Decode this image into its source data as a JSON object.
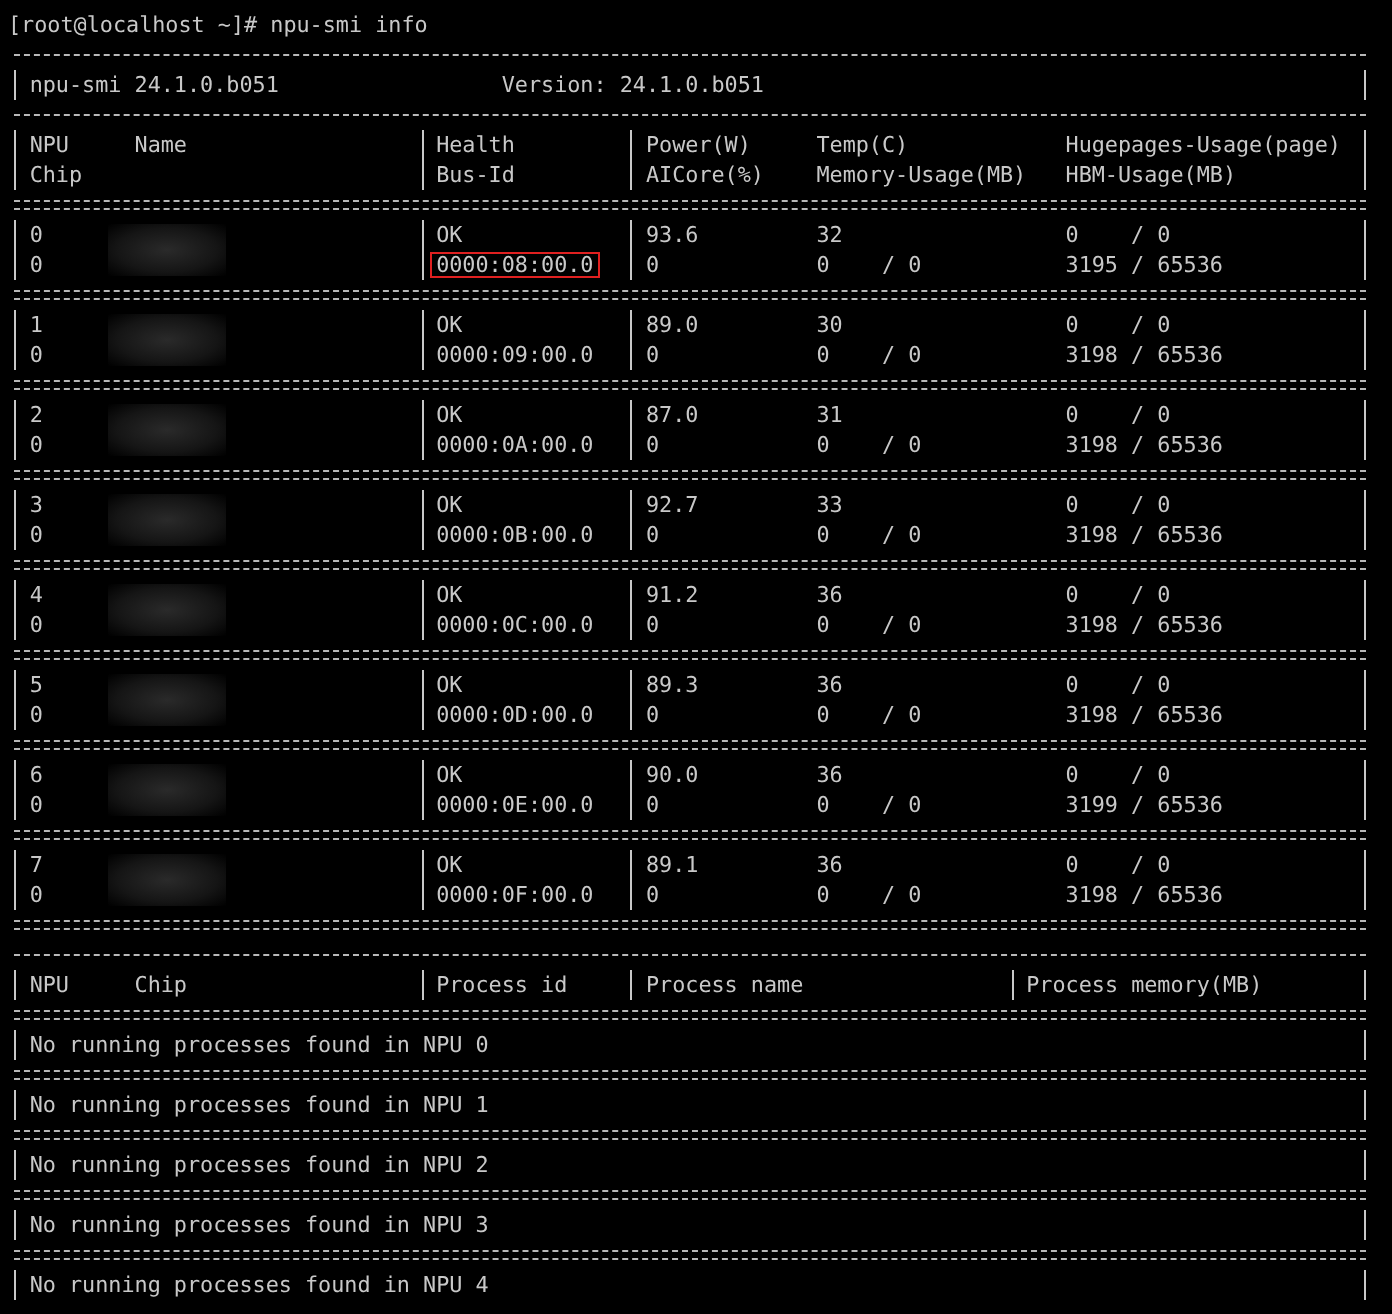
{
  "prompt": "[root@localhost ~]# npu-smi info",
  "header": {
    "tool": "npu-smi 24.1.0.b051",
    "version": "Version: 24.1.0.b051"
  },
  "columns": {
    "npu": "NPU",
    "name": "Name",
    "chip": "Chip",
    "health": "Health",
    "bus_id": "Bus-Id",
    "power": "Power(W)",
    "aicore": "AICore(%)",
    "temp": "Temp(C)",
    "memory": "Memory-Usage(MB)",
    "hugepages": "Hugepages-Usage(page)",
    "hbm": "HBM-Usage(MB)"
  },
  "npus": [
    {
      "npu": "0",
      "chip": "0",
      "health": "OK",
      "bus_id": "0000:08:00.0",
      "highlighted": true,
      "power": "93.6",
      "aicore": "0",
      "temp": "32",
      "memory": "0    / 0",
      "hugepages": "0    / 0",
      "hbm": "3195 / 65536"
    },
    {
      "npu": "1",
      "chip": "0",
      "health": "OK",
      "bus_id": "0000:09:00.0",
      "highlighted": false,
      "power": "89.0",
      "aicore": "0",
      "temp": "30",
      "memory": "0    / 0",
      "hugepages": "0    / 0",
      "hbm": "3198 / 65536"
    },
    {
      "npu": "2",
      "chip": "0",
      "health": "OK",
      "bus_id": "0000:0A:00.0",
      "highlighted": false,
      "power": "87.0",
      "aicore": "0",
      "temp": "31",
      "memory": "0    / 0",
      "hugepages": "0    / 0",
      "hbm": "3198 / 65536"
    },
    {
      "npu": "3",
      "chip": "0",
      "health": "OK",
      "bus_id": "0000:0B:00.0",
      "highlighted": false,
      "power": "92.7",
      "aicore": "0",
      "temp": "33",
      "memory": "0    / 0",
      "hugepages": "0    / 0",
      "hbm": "3198 / 65536"
    },
    {
      "npu": "4",
      "chip": "0",
      "health": "OK",
      "bus_id": "0000:0C:00.0",
      "highlighted": false,
      "power": "91.2",
      "aicore": "0",
      "temp": "36",
      "memory": "0    / 0",
      "hugepages": "0    / 0",
      "hbm": "3198 / 65536"
    },
    {
      "npu": "5",
      "chip": "0",
      "health": "OK",
      "bus_id": "0000:0D:00.0",
      "highlighted": false,
      "power": "89.3",
      "aicore": "0",
      "temp": "36",
      "memory": "0    / 0",
      "hugepages": "0    / 0",
      "hbm": "3198 / 65536"
    },
    {
      "npu": "6",
      "chip": "0",
      "health": "OK",
      "bus_id": "0000:0E:00.0",
      "highlighted": false,
      "power": "90.0",
      "aicore": "0",
      "temp": "36",
      "memory": "0    / 0",
      "hugepages": "0    / 0",
      "hbm": "3199 / 65536"
    },
    {
      "npu": "7",
      "chip": "0",
      "health": "OK",
      "bus_id": "0000:0F:00.0",
      "highlighted": false,
      "power": "89.1",
      "aicore": "0",
      "temp": "36",
      "memory": "0    / 0",
      "hugepages": "0    / 0",
      "hbm": "3198 / 65536"
    }
  ],
  "process_columns": [
    "NPU",
    "Chip",
    "Process id",
    "Process name",
    "Process memory(MB)"
  ],
  "process_rows": [
    "No running processes found in NPU 0",
    "No running processes found in NPU 1",
    "No running processes found in NPU 2",
    "No running processes found in NPU 3",
    "No running processes found in NPU 4"
  ]
}
